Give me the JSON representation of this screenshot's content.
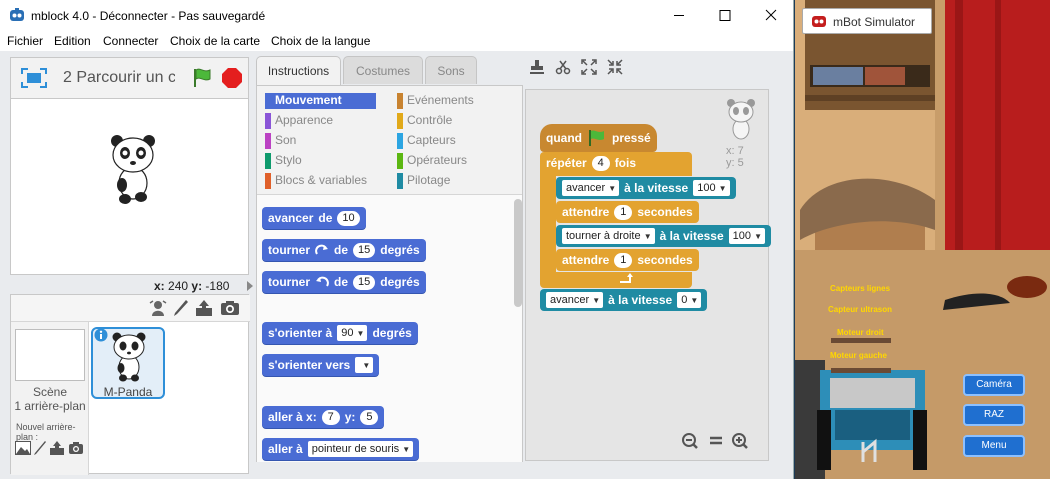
{
  "window": {
    "title": "mblock 4.0 - Déconnecter - Pas sauvegardé"
  },
  "menu": [
    "Fichier",
    "Edition",
    "Connecter",
    "Choix de la carte",
    "Choix de la langue"
  ],
  "stage": {
    "project_name": "2 Parcourir un c",
    "x_label": "x:",
    "x_value": "240",
    "y_label": "y:",
    "y_value": "-180"
  },
  "sprites": {
    "scene_label": "Scène",
    "backdrop_count": "1 arrière-plan",
    "new_backdrop": "Nouvel arrière-plan :",
    "sprite_name": "M-Panda"
  },
  "tabs": [
    "Instructions",
    "Costumes",
    "Sons"
  ],
  "categories": {
    "left": [
      {
        "label": "Mouvement",
        "color": "#4a6cd4"
      },
      {
        "label": "Apparence",
        "color": "#8a55d7"
      },
      {
        "label": "Son",
        "color": "#bb42c3"
      },
      {
        "label": "Stylo",
        "color": "#0e9a6c"
      },
      {
        "label": "Blocs & variables",
        "color": "#e0602a"
      }
    ],
    "right": [
      {
        "label": "Evénements",
        "color": "#c88330"
      },
      {
        "label": "Contrôle",
        "color": "#e1a91a"
      },
      {
        "label": "Capteurs",
        "color": "#2ca5e2"
      },
      {
        "label": "Opérateurs",
        "color": "#5cb712"
      },
      {
        "label": "Pilotage",
        "color": "#1f8ba3"
      }
    ]
  },
  "palette_blocks": {
    "b1": {
      "a": "avancer",
      "b": "de",
      "n": "10"
    },
    "b2": {
      "a": "tourner",
      "b": "de",
      "n": "15",
      "c": "degrés"
    },
    "b3": {
      "a": "tourner",
      "b": "de",
      "n": "15",
      "c": "degrés"
    },
    "b4": {
      "a": "s'orienter à",
      "n": "90",
      "c": "degrés"
    },
    "b5": {
      "a": "s'orienter vers"
    },
    "b6": {
      "a": "aller à x:",
      "n1": "7",
      "b": "y:",
      "n2": "5"
    },
    "b7": {
      "a": "aller à",
      "d": "pointeur de souris"
    }
  },
  "script": {
    "hat": {
      "a": "quand",
      "b": "pressé"
    },
    "repeat": {
      "a": "répéter",
      "n": "4",
      "b": "fois"
    },
    "s1": {
      "d": "avancer",
      "a": "à la vitesse",
      "n": "100"
    },
    "s2": {
      "a": "attendre",
      "n": "1",
      "b": "secondes"
    },
    "s3": {
      "d": "tourner à droite",
      "a": "à la vitesse",
      "n": "100"
    },
    "s4": {
      "a": "attendre",
      "n": "1",
      "b": "secondes"
    },
    "s5": {
      "d": "avancer",
      "a": "à la vitesse",
      "n": "0"
    },
    "sprite_x": "x: 7",
    "sprite_y": "y: 5"
  },
  "simulator": {
    "tab_title": "mBot Simulator",
    "buttons": [
      "Caméra",
      "RAZ",
      "Menu"
    ],
    "sensors": [
      "Capteurs lignes",
      "Capteur ultrason",
      "Moteur droit",
      "Moteur gauche"
    ]
  }
}
